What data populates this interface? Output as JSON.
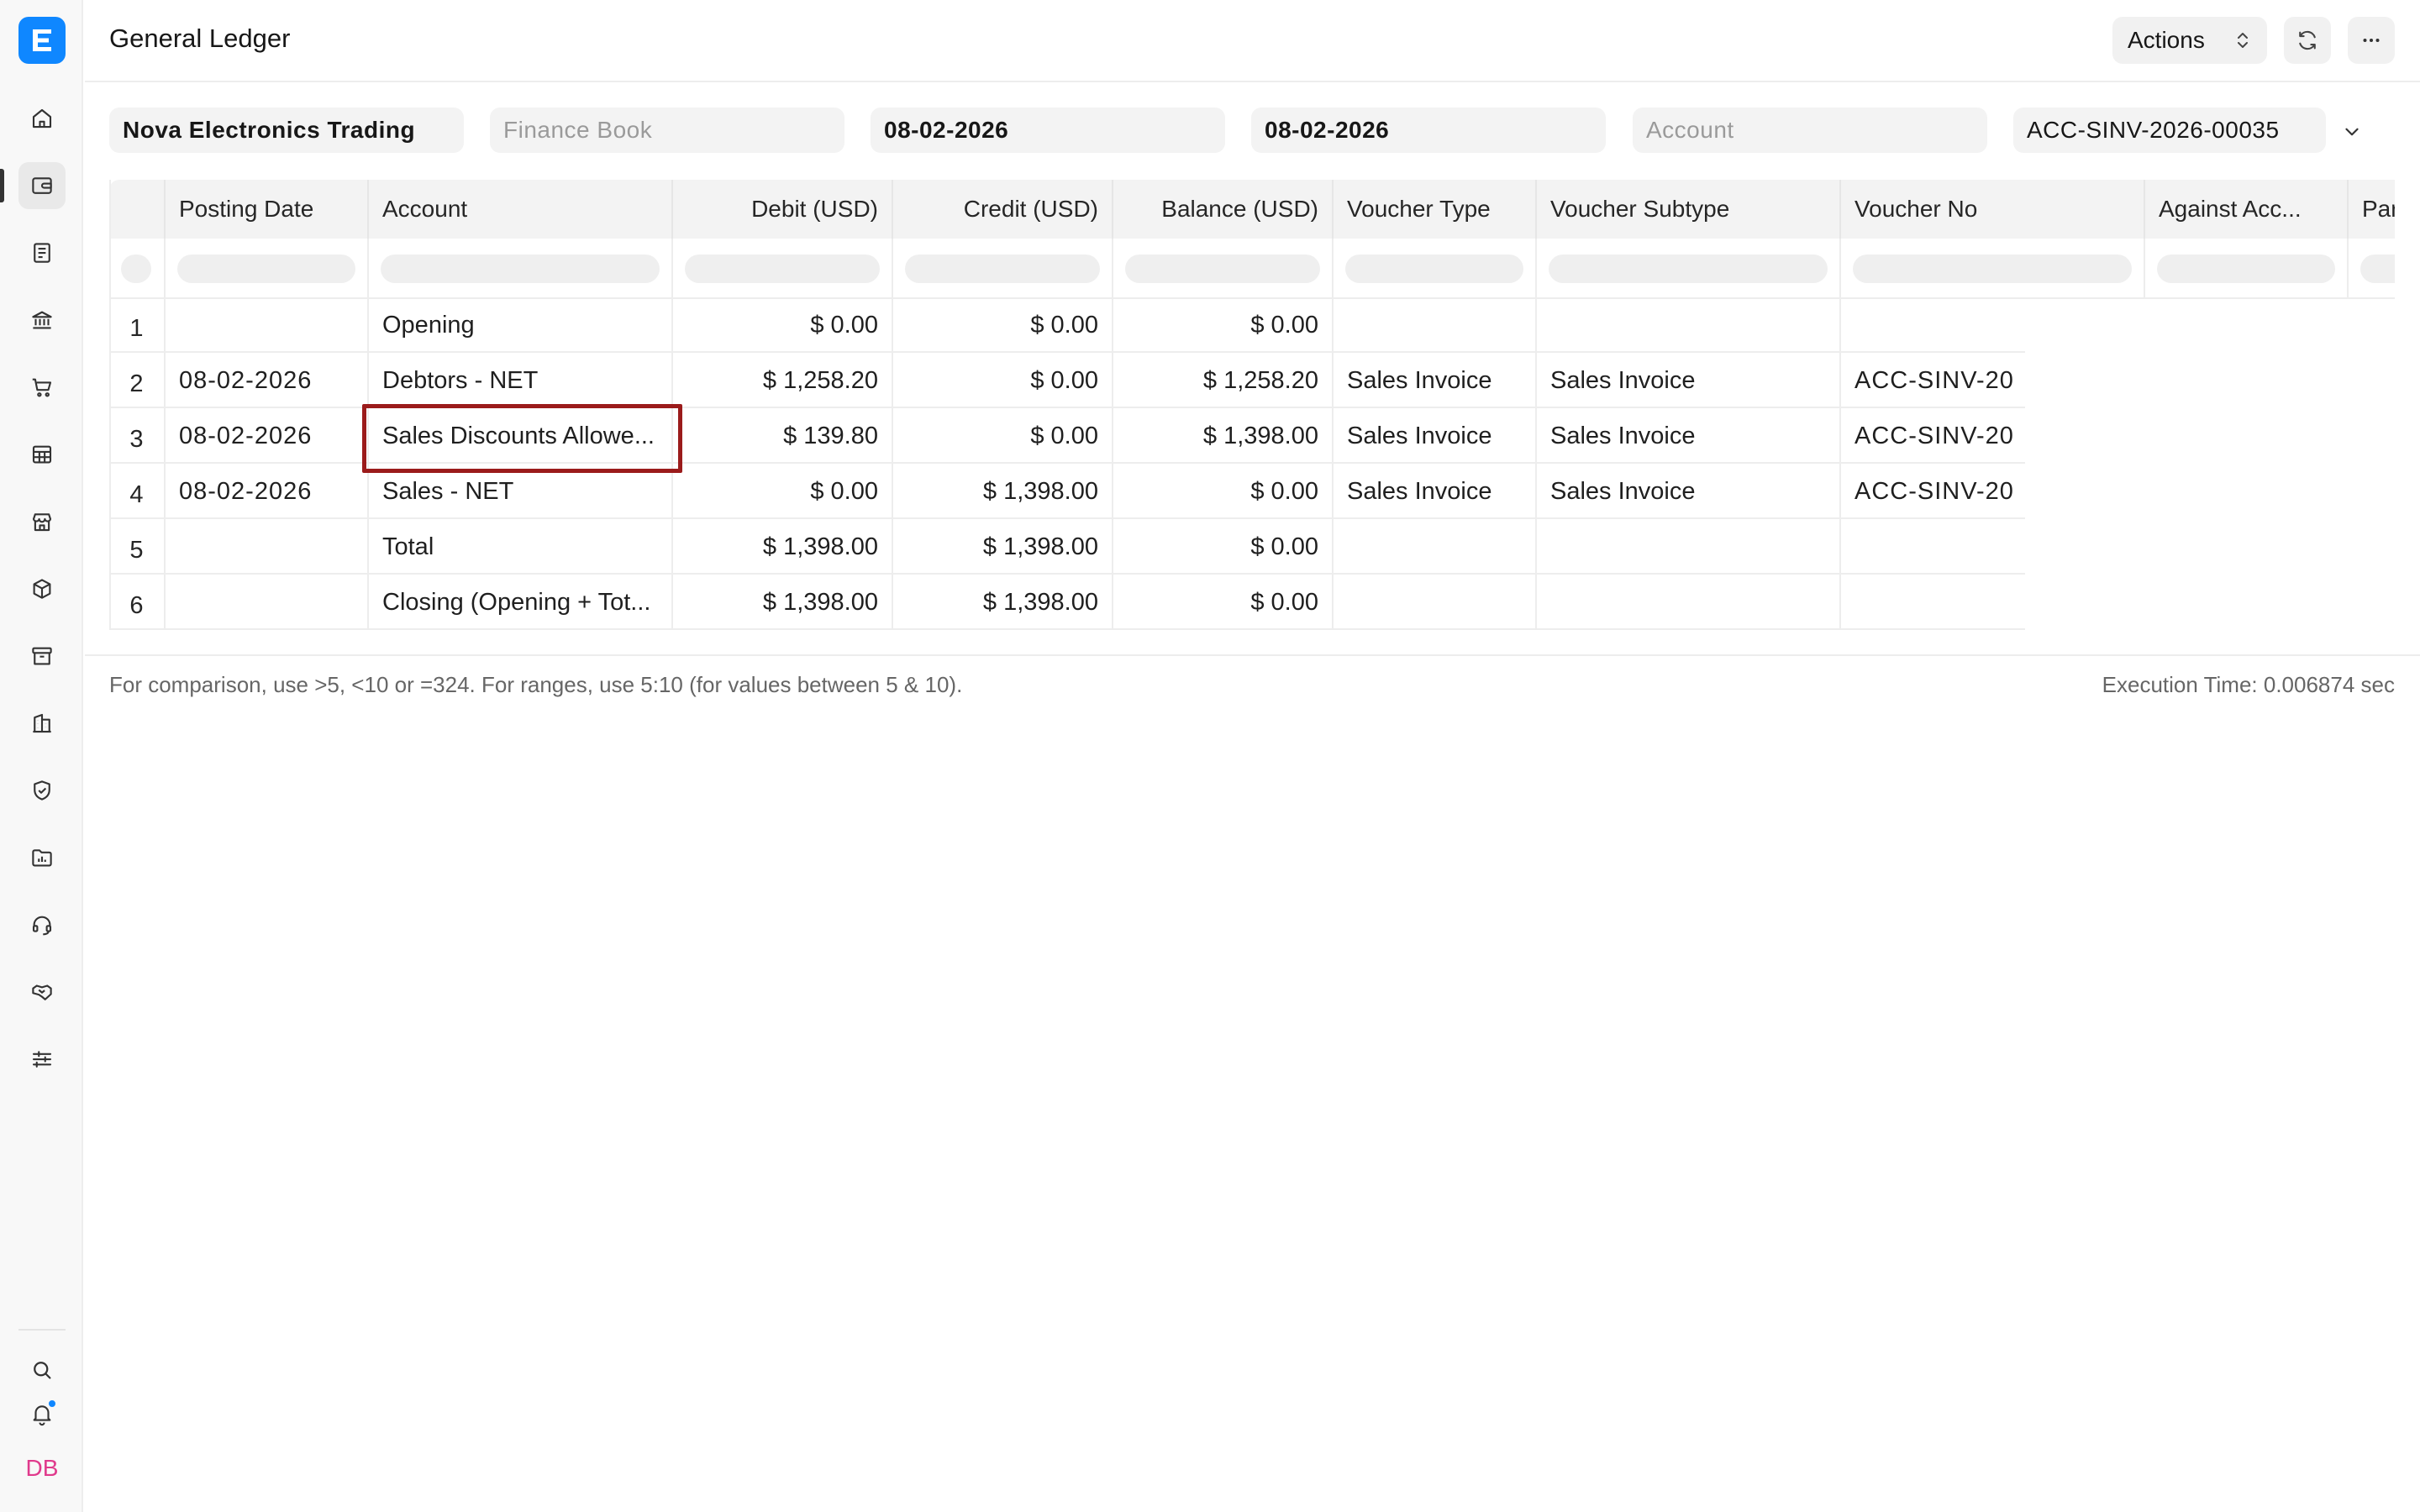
{
  "app": {
    "logo_letter": "E",
    "avatar_initials": "DB",
    "brand_color": "#0f87ff"
  },
  "sidebar": {
    "items": [
      {
        "name": "home",
        "icon": "home-icon"
      },
      {
        "name": "accounting",
        "icon": "wallet-icon",
        "active": true
      },
      {
        "name": "documents",
        "icon": "document-icon"
      },
      {
        "name": "banking",
        "icon": "bank-icon"
      },
      {
        "name": "buying",
        "icon": "cart-icon"
      },
      {
        "name": "reports",
        "icon": "table-icon"
      },
      {
        "name": "selling",
        "icon": "store-icon"
      },
      {
        "name": "stock",
        "icon": "box-icon"
      },
      {
        "name": "archive",
        "icon": "archive-icon"
      },
      {
        "name": "assets",
        "icon": "building-icon"
      },
      {
        "name": "quality",
        "icon": "shield-check-icon"
      },
      {
        "name": "projects",
        "icon": "folder-chart-icon"
      },
      {
        "name": "support",
        "icon": "headset-icon"
      },
      {
        "name": "crm",
        "icon": "handshake-icon"
      },
      {
        "name": "settings",
        "icon": "sliders-icon"
      }
    ],
    "bottom": [
      {
        "name": "search",
        "icon": "search-icon"
      },
      {
        "name": "notifications",
        "icon": "bell-icon"
      }
    ]
  },
  "header": {
    "title": "General Ledger",
    "actions_label": "Actions"
  },
  "filters": {
    "company": "Nova Electronics Trading",
    "finance_book_placeholder": "Finance Book",
    "from_date": "08-02-2026",
    "to_date": "08-02-2026",
    "account_placeholder": "Account",
    "voucher_no": "ACC-SINV-2026-00035"
  },
  "table": {
    "columns": [
      "Posting Date",
      "Account",
      "Debit (USD)",
      "Credit (USD)",
      "Balance (USD)",
      "Voucher Type",
      "Voucher Subtype",
      "Voucher No",
      "Against Acc...",
      "Par"
    ],
    "rows": [
      {
        "idx": "1",
        "posting_date": "",
        "account": "Opening",
        "debit": "$ 0.00",
        "credit": "$ 0.00",
        "balance": "$ 0.00",
        "voucher_type": "",
        "voucher_subtype": "",
        "voucher_no": ""
      },
      {
        "idx": "2",
        "posting_date": "08-02-2026",
        "account": "Debtors - NET",
        "debit": "$ 1,258.20",
        "credit": "$ 0.00",
        "balance": "$ 1,258.20",
        "voucher_type": "Sales Invoice",
        "voucher_subtype": "Sales Invoice",
        "voucher_no": "ACC-SINV-20"
      },
      {
        "idx": "3",
        "posting_date": "08-02-2026",
        "account": "Sales Discounts Allowe...",
        "debit": "$ 139.80",
        "credit": "$ 0.00",
        "balance": "$ 1,398.00",
        "voucher_type": "Sales Invoice",
        "voucher_subtype": "Sales Invoice",
        "voucher_no": "ACC-SINV-20"
      },
      {
        "idx": "4",
        "posting_date": "08-02-2026",
        "account": "Sales - NET",
        "debit": "$ 0.00",
        "credit": "$ 1,398.00",
        "balance": "$ 0.00",
        "voucher_type": "Sales Invoice",
        "voucher_subtype": "Sales Invoice",
        "voucher_no": "ACC-SINV-20"
      },
      {
        "idx": "5",
        "posting_date": "",
        "account": "Total",
        "debit": "$ 1,398.00",
        "credit": "$ 1,398.00",
        "balance": "$ 0.00",
        "voucher_type": "",
        "voucher_subtype": "",
        "voucher_no": ""
      },
      {
        "idx": "6",
        "posting_date": "",
        "account": "Closing (Opening + Tot...",
        "debit": "$ 1,398.00",
        "credit": "$ 1,398.00",
        "balance": "$ 0.00",
        "voucher_type": "",
        "voucher_subtype": "",
        "voucher_no": ""
      }
    ]
  },
  "footer": {
    "note": "For comparison, use >5, <10 or =324. For ranges, use 5:10 (for values between 5 & 10).",
    "execution_time": "Execution Time: 0.006874 sec"
  }
}
